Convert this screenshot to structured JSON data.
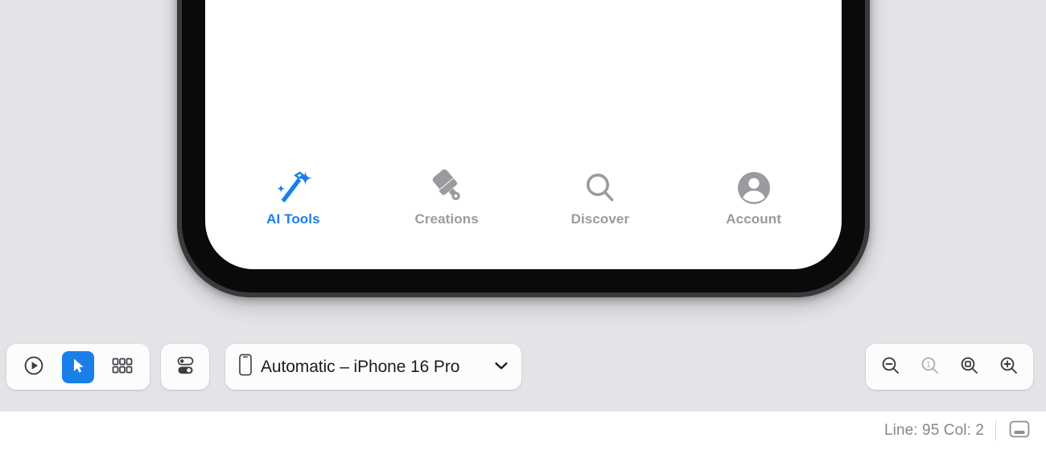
{
  "canvas": {
    "background_color": "#e2e4e8",
    "device": {
      "name": "iphone-16-pro-frame",
      "bezel_color": "#0a0a0a",
      "edge_color": "#3a3a3c",
      "screen_color": "#ffffff"
    }
  },
  "app_preview": {
    "tabbar": {
      "active_color": "#1a7fe8",
      "inactive_color": "#9b9b9f",
      "tabs": [
        {
          "label": "AI Tools",
          "icon": "magic-wand-sparkles-icon",
          "active": true
        },
        {
          "label": "Creations",
          "icon": "paintbrush-icon",
          "active": false
        },
        {
          "label": "Discover",
          "icon": "magnifying-glass-icon",
          "active": false
        },
        {
          "label": "Account",
          "icon": "person-circle-icon",
          "active": false
        }
      ]
    }
  },
  "toolbar": {
    "mode_group": [
      {
        "name": "play-preview-button",
        "icon": "play-circle-icon",
        "selected": false
      },
      {
        "name": "select-pointer-button",
        "icon": "cursor-arrow-icon",
        "selected": true
      },
      {
        "name": "variants-grid-button",
        "icon": "grid-6-icon",
        "selected": false
      }
    ],
    "settings_group": [
      {
        "name": "preview-settings-button",
        "icon": "toggles-icon",
        "selected": false
      }
    ],
    "device_selector": {
      "icon": "iphone-icon",
      "label": "Automatic – iPhone 16 Pro",
      "chevron": "chevron-down-icon"
    },
    "zoom_group": [
      {
        "name": "zoom-out-button",
        "icon": "magnifier-minus-icon",
        "enabled": true
      },
      {
        "name": "zoom-actual-size-button",
        "icon": "magnifier-one-icon",
        "enabled": false,
        "value": "1"
      },
      {
        "name": "zoom-to-fit-button",
        "icon": "magnifier-fit-icon",
        "enabled": true
      },
      {
        "name": "zoom-in-button",
        "icon": "magnifier-plus-icon",
        "enabled": true
      }
    ]
  },
  "statusbar": {
    "line_col": "Line: 95  Col: 2",
    "panel_toggle": {
      "name": "inspector-panel-toggle",
      "icon": "bottom-panel-icon"
    },
    "text_color": "#86868b"
  }
}
